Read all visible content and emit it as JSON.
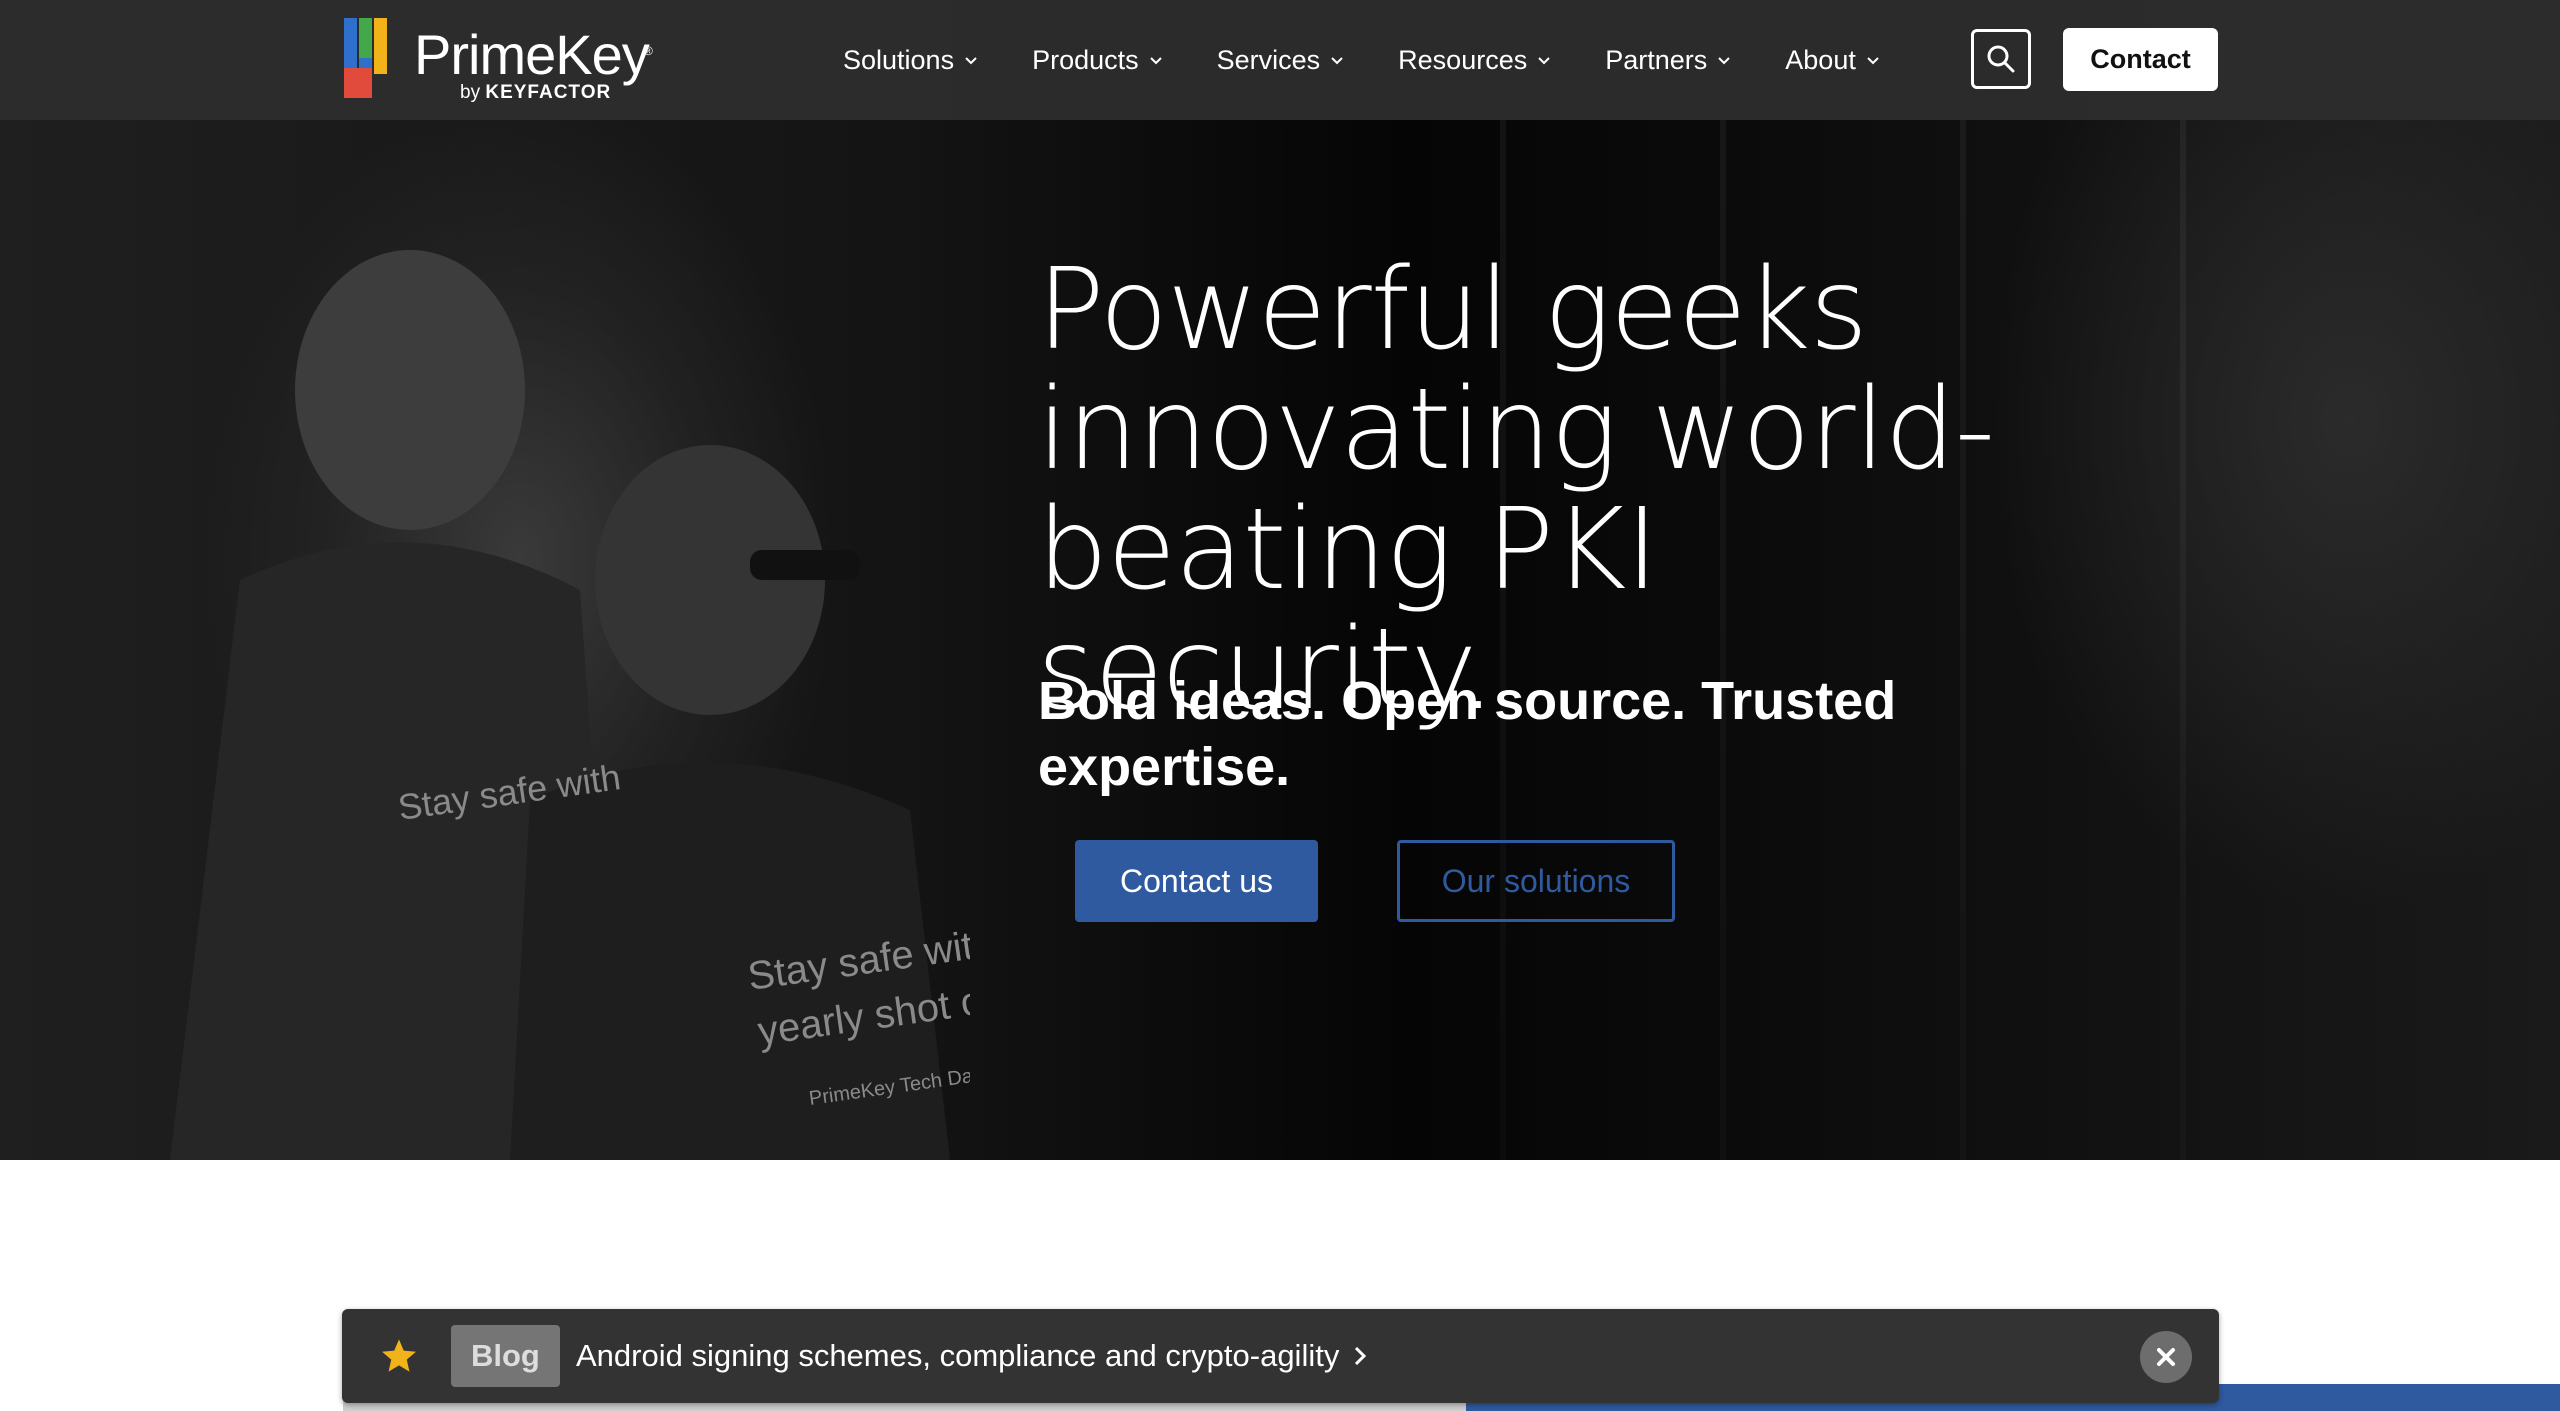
{
  "brand": {
    "name": "PrimeKey",
    "registered": "®",
    "by_prefix": "by",
    "by_name": "KEYFACTOR",
    "logo_colors": [
      "#2f6fce",
      "#42a84a",
      "#f2b21a",
      "#e04b3c"
    ]
  },
  "nav": {
    "items": [
      {
        "label": "Solutions"
      },
      {
        "label": "Products"
      },
      {
        "label": "Services"
      },
      {
        "label": "Resources"
      },
      {
        "label": "Partners"
      },
      {
        "label": "About"
      }
    ],
    "search_icon": "search-icon",
    "contact_label": "Contact"
  },
  "hero": {
    "title": "Powerful geeks innovating world-beating PKI security.",
    "subtitle": "Bold ideas. Open source. Trusted expertise.",
    "primary_cta": "Contact us",
    "secondary_cta": "Our solutions",
    "shirt_text_1": "Stay safe with",
    "shirt_text_2": "yearly shot of",
    "shirt_text_3": "PrimeKey Tech Days"
  },
  "notice": {
    "icon": "star-icon",
    "badge": "Blog",
    "link_text": "Android signing schemes, compliance and crypto-agility",
    "close_icon": "close-icon"
  },
  "colors": {
    "accent_blue": "#2f5aa0",
    "nav_bg": "#2d2d2d",
    "notice_bg": "#333333",
    "star": "#f2b21a"
  }
}
